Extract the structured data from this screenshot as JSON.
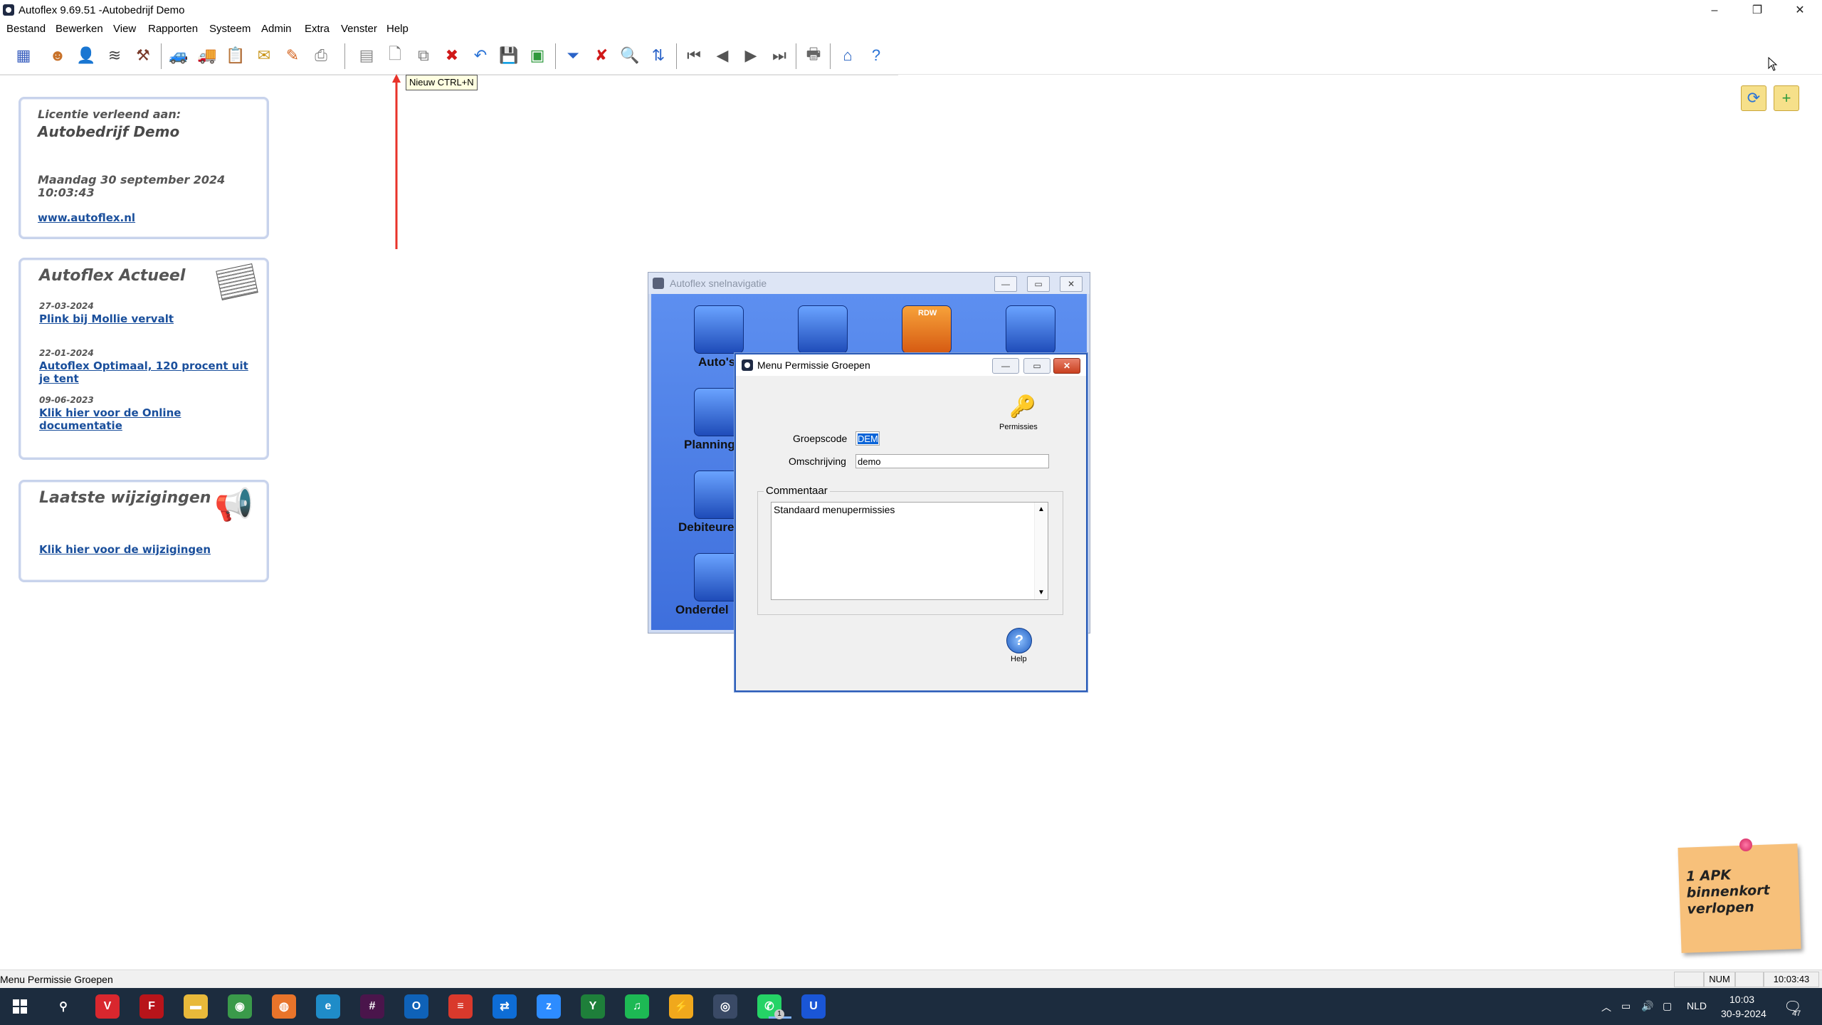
{
  "window": {
    "title": "Autoflex 9.69.51 -Autobedrijf Demo",
    "controls": {
      "minimize": "–",
      "restore": "❐",
      "close": "✕"
    }
  },
  "menu": [
    "Bestand",
    "Bewerken",
    "View",
    "Rapporten",
    "Systeem",
    "Admin",
    "Extra",
    "Venster",
    "Help"
  ],
  "toolbar": {
    "tooltip": "Nieuw CTRL+N",
    "buttons": [
      {
        "name": "grid-icon",
        "glyph": "▦",
        "color": "#3a5fbf"
      },
      {
        "name": "people-icon",
        "glyph": "☻",
        "color": "#c8722a"
      },
      {
        "name": "person-icon",
        "glyph": "👤",
        "color": "#2d5db5"
      },
      {
        "name": "parts-icon",
        "glyph": "≋",
        "color": "#444"
      },
      {
        "name": "tools-icon",
        "glyph": "⚒",
        "color": "#7a3a2a"
      },
      {
        "name": "car-icon",
        "glyph": "🚙",
        "color": "#666"
      },
      {
        "name": "truck-icon",
        "glyph": "🚚",
        "color": "#666"
      },
      {
        "name": "clipboard-icon",
        "glyph": "📋",
        "color": "#b8860b"
      },
      {
        "name": "document-icon",
        "glyph": "✉",
        "color": "#c89418"
      },
      {
        "name": "pencil-icon",
        "glyph": "✎",
        "color": "#d4621c"
      },
      {
        "name": "printer-icon",
        "glyph": "⎙",
        "color": "#777"
      },
      {
        "name": "table-icon",
        "glyph": "▤",
        "color": "#888"
      },
      {
        "name": "new-document-icon",
        "glyph": "🗋",
        "color": "#777"
      },
      {
        "name": "copy-icon",
        "glyph": "⧉",
        "color": "#777"
      },
      {
        "name": "delete-icon",
        "glyph": "✖",
        "color": "#d01818"
      },
      {
        "name": "undo-icon",
        "glyph": "↶",
        "color": "#2a73d6"
      },
      {
        "name": "save-icon",
        "glyph": "💾",
        "color": "#2d5db5"
      },
      {
        "name": "save-close-icon",
        "glyph": "▣",
        "color": "#2e9a3d"
      },
      {
        "name": "filter-icon",
        "glyph": "⏷",
        "color": "#2a63c8"
      },
      {
        "name": "clear-filter-icon",
        "glyph": "✘",
        "color": "#d01818"
      },
      {
        "name": "search-icon",
        "glyph": "🔍",
        "color": "#555"
      },
      {
        "name": "sort-icon",
        "glyph": "⇅",
        "color": "#2a63c8"
      },
      {
        "name": "first-record-icon",
        "glyph": "⏮",
        "color": "#555"
      },
      {
        "name": "previous-record-icon",
        "glyph": "◀",
        "color": "#555"
      },
      {
        "name": "next-record-icon",
        "glyph": "▶",
        "color": "#555"
      },
      {
        "name": "last-record-icon",
        "glyph": "⏭",
        "color": "#555"
      },
      {
        "name": "print-icon",
        "glyph": "🖶",
        "color": "#666"
      },
      {
        "name": "home-icon",
        "glyph": "⌂",
        "color": "#1f5cc0"
      },
      {
        "name": "help-icon",
        "glyph": "?",
        "color": "#2a73d6"
      }
    ]
  },
  "license": {
    "heading": "Licentie verleend aan:",
    "company": "Autobedrijf Demo",
    "date": "Maandag 30 september 2024",
    "time": "10:03:43",
    "website": "www.autoflex.nl"
  },
  "news": {
    "heading": "Autoflex Actueel",
    "items": [
      {
        "date": "27-03-2024",
        "title": "Plink bij Mollie vervalt"
      },
      {
        "date": "22-01-2024",
        "title": "Autoflex Optimaal, 120 procent uit je tent"
      },
      {
        "date": "09-06-2023",
        "title": "Klik hier voor de Online documentatie"
      }
    ]
  },
  "changes": {
    "heading": "Laatste wijzigingen",
    "link": "Klik hier voor de wijzigingen"
  },
  "snelnavigatie": {
    "title": "Autoflex snelnavigatie",
    "items": [
      "Auto's",
      "Planning",
      "Debiteure",
      "Onderdel"
    ],
    "rdw_badge": "RDW"
  },
  "dialog": {
    "title": "Menu Permissie Groepen",
    "permissions_label": "Permissies",
    "groepscode_label": "Groepscode",
    "groepscode_value": "DEM",
    "omschrijving_label": "Omschrijving",
    "omschrijving_value": "demo",
    "commentaar_label": "Commentaar",
    "commentaar_value": "Standaard menupermissies",
    "help_label": "Help"
  },
  "sticky": {
    "text": "1 APK binnenkort verlopen"
  },
  "status": {
    "text": "Menu Permissie Groepen",
    "num": "NUM",
    "time": "10:03:43"
  },
  "taskbar": {
    "apps": [
      {
        "name": "search",
        "glyph": "⚲",
        "bg": "transparent"
      },
      {
        "name": "vivaldi",
        "glyph": "V",
        "bg": "#d9272e"
      },
      {
        "name": "filezilla",
        "glyph": "F",
        "bg": "#b8141a"
      },
      {
        "name": "explorer",
        "glyph": "▬",
        "bg": "#e8b93a"
      },
      {
        "name": "chrome",
        "glyph": "◉",
        "bg": "#3a9a4a"
      },
      {
        "name": "firefox",
        "glyph": "◍",
        "bg": "#e8742a"
      },
      {
        "name": "edge",
        "glyph": "e",
        "bg": "#1f8cc8"
      },
      {
        "name": "slack",
        "glyph": "#",
        "bg": "#4a154b"
      },
      {
        "name": "outlook",
        "glyph": "O",
        "bg": "#0f62b8"
      },
      {
        "name": "todoist",
        "glyph": "≡",
        "bg": "#d9392c"
      },
      {
        "name": "teamviewer",
        "glyph": "⇄",
        "bg": "#0e6dd6"
      },
      {
        "name": "zoom",
        "glyph": "z",
        "bg": "#2d8cff"
      },
      {
        "name": "yapp",
        "glyph": "Y",
        "bg": "#1e7f3a"
      },
      {
        "name": "spotify",
        "glyph": "♫",
        "bg": "#1db954"
      },
      {
        "name": "mcafee",
        "glyph": "⚡",
        "bg": "#f0a81c"
      },
      {
        "name": "autoflex",
        "glyph": "◎",
        "bg": "#3a4a66"
      },
      {
        "name": "whatsapp",
        "glyph": "✆",
        "bg": "#25d366"
      },
      {
        "name": "unknown-u",
        "glyph": "U",
        "bg": "#1a56d6"
      }
    ],
    "whatsapp_badge": "1",
    "lang": "NLD",
    "clock_time": "10:03",
    "clock_date": "30-9-2024",
    "notifications": "47"
  }
}
